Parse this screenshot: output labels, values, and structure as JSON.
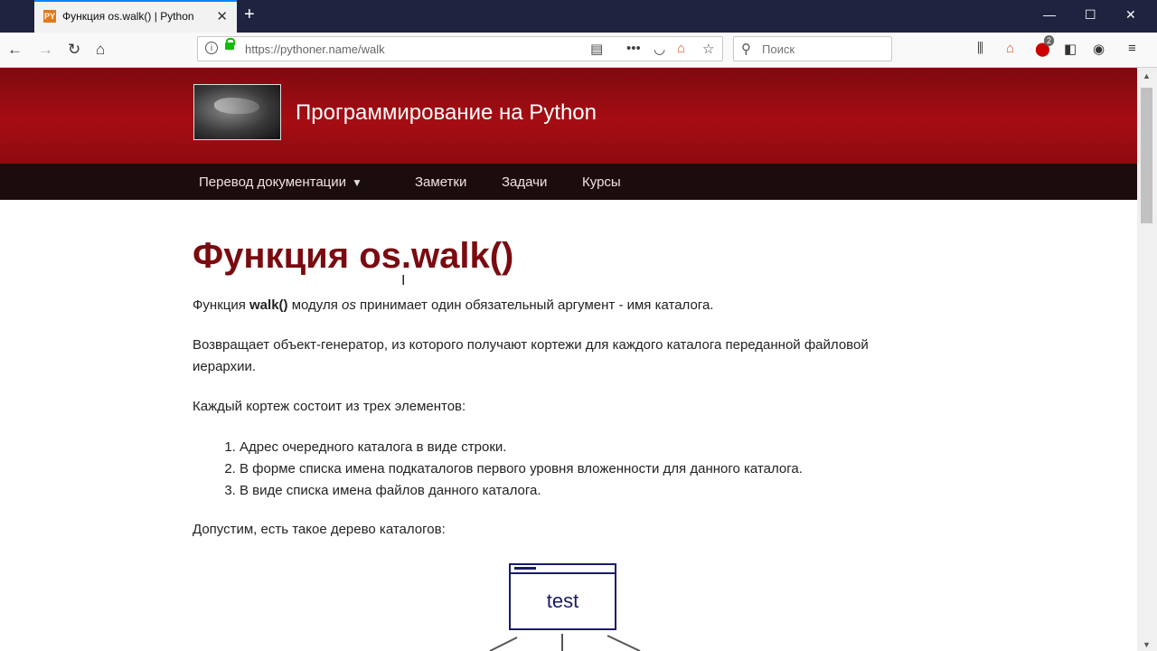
{
  "browser": {
    "tab_title": "Функция os.walk() | Python",
    "tab_favicon_text": "PY",
    "url": "https://pythoner.name/walk",
    "search_placeholder": "Поиск",
    "badge_count": "2",
    "icons": {
      "back": "back-arrow-icon",
      "forward": "forward-arrow-icon",
      "reload": "reload-icon",
      "home": "home-icon",
      "reader": "reader-view-icon",
      "more": "page-actions-icon",
      "pocket": "pocket-icon",
      "star": "bookmark-star-icon",
      "library": "library-icon",
      "sidebar": "sidebar-icon",
      "menu": "hamburger-menu-icon"
    }
  },
  "site": {
    "title": "Программирование на Python",
    "nav": [
      "Перевод документации",
      "Заметки",
      "Задачи",
      "Курсы"
    ]
  },
  "article": {
    "heading": "Функция os.walk()",
    "p1_prefix": "Функция ",
    "p1_bold": "walk()",
    "p1_mid": " модуля ",
    "p1_italic": "os",
    "p1_suffix": " принимает один обязательный аргумент - имя каталога.",
    "p2": "Возвращает объект-генератор, из которого получают кортежи для каждого каталога переданной файловой иерархии.",
    "p3": "Каждый кортеж состоит из трех элементов:",
    "list": [
      "Адрес очередного каталога в виде строки.",
      "В форме списка имена подкаталогов первого уровня вложенности для данного каталога.",
      "В виде списка имена файлов данного каталога."
    ],
    "p4": "Допустим, есть такое дерево каталогов:",
    "diagram_root": "test"
  },
  "colors": {
    "header_red": "#a60d13",
    "nav_dark": "#1b0d0b",
    "heading": "#7a0b10",
    "diagram": "#1a1a6b"
  }
}
